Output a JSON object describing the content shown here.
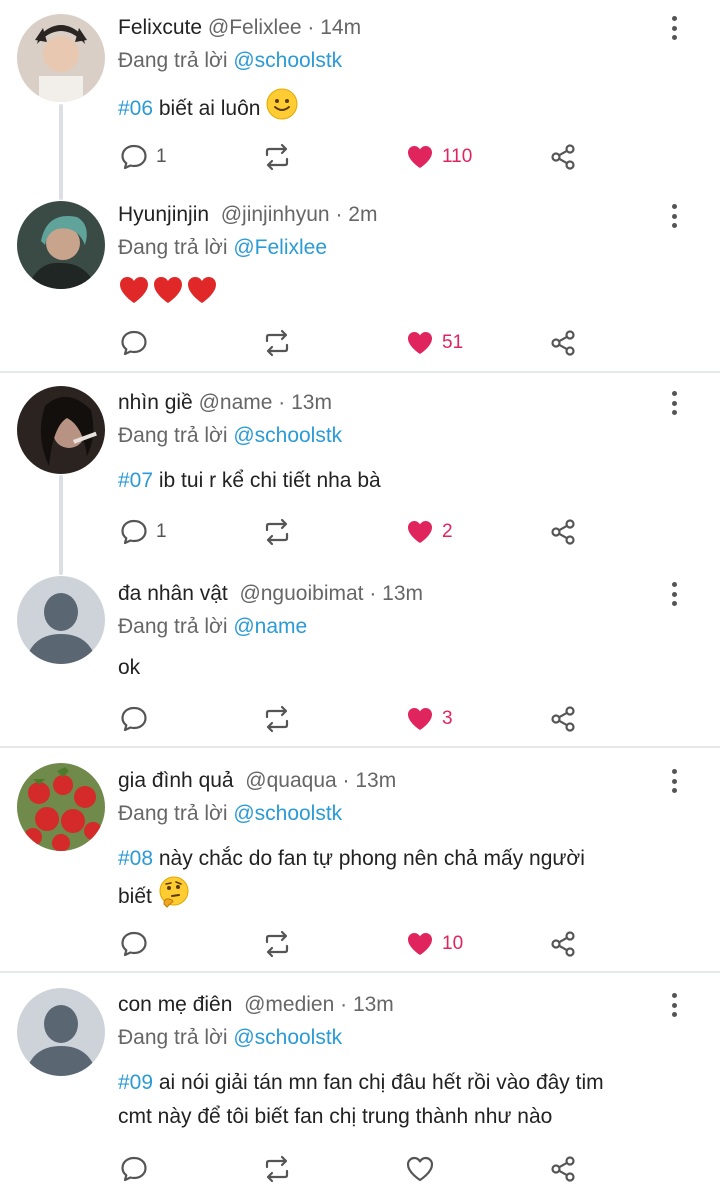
{
  "posts": [
    {
      "name": "Felixcute",
      "handle": "@Felixlee",
      "time": "· 14m",
      "reply_prefix": "Đang trả lời",
      "reply_to": "@schoolstk",
      "tag": "#06",
      "text": " biết ai luôn ",
      "text2": "",
      "emoji": "slightly-smiling-face",
      "comments": "1",
      "likes": "110",
      "liked": true
    },
    {
      "name": "Hyunjinjin",
      "handle": "@jinjinhyun",
      "time": "· 2m",
      "reply_prefix": "Đang trả lời",
      "reply_to": "@Felixlee",
      "tag": "",
      "text": "",
      "emoji": "three-red-hearts",
      "comments": "",
      "likes": "51",
      "liked": true
    },
    {
      "name": "nhìn giề",
      "handle": "@name",
      "time": "· 13m",
      "reply_prefix": "Đang trả lời",
      "reply_to": "@schoolstk",
      "tag": "#07",
      "text": " ib tui r kể chi tiết nha bà",
      "comments": "1",
      "likes": "2",
      "liked": true
    },
    {
      "name": "đa nhân vật",
      "handle": "@nguoibimat",
      "time": "· 13m",
      "reply_prefix": "Đang trả lời",
      "reply_to": "@name",
      "tag": "",
      "text": "ok",
      "comments": "",
      "likes": "3",
      "liked": true
    },
    {
      "name": "gia đình quả",
      "handle": "@quaqua",
      "time": "· 13m",
      "reply_prefix": "Đang trả lời",
      "reply_to": "@schoolstk",
      "tag": "#08",
      "text": " này chắc do fan tự phong nên chả mấy người",
      "text2": "biết ",
      "emoji": "thinking-face",
      "comments": "",
      "likes": "10",
      "liked": true
    },
    {
      "name": "con mẹ điên",
      "handle": "@medien",
      "time": "· 13m",
      "reply_prefix": "Đang trả lời",
      "reply_to": "@schoolstk",
      "tag": "#09",
      "text": " ai nói giải tán mn fan chị đâu hết rồi vào đây tim",
      "text2": "cmt này để tôi biết fan chị trung thành như nào",
      "comments": "",
      "likes": "",
      "liked": false
    }
  ],
  "icons": {
    "comment": "comment-bubble-icon",
    "repost": "repost-arrows-icon",
    "like": "heart-icon",
    "share": "share-icon",
    "more": "more-vertical-icon"
  },
  "colors": {
    "mention": "#2b9bd6",
    "like": "#e0245e",
    "icon": "#555555"
  }
}
